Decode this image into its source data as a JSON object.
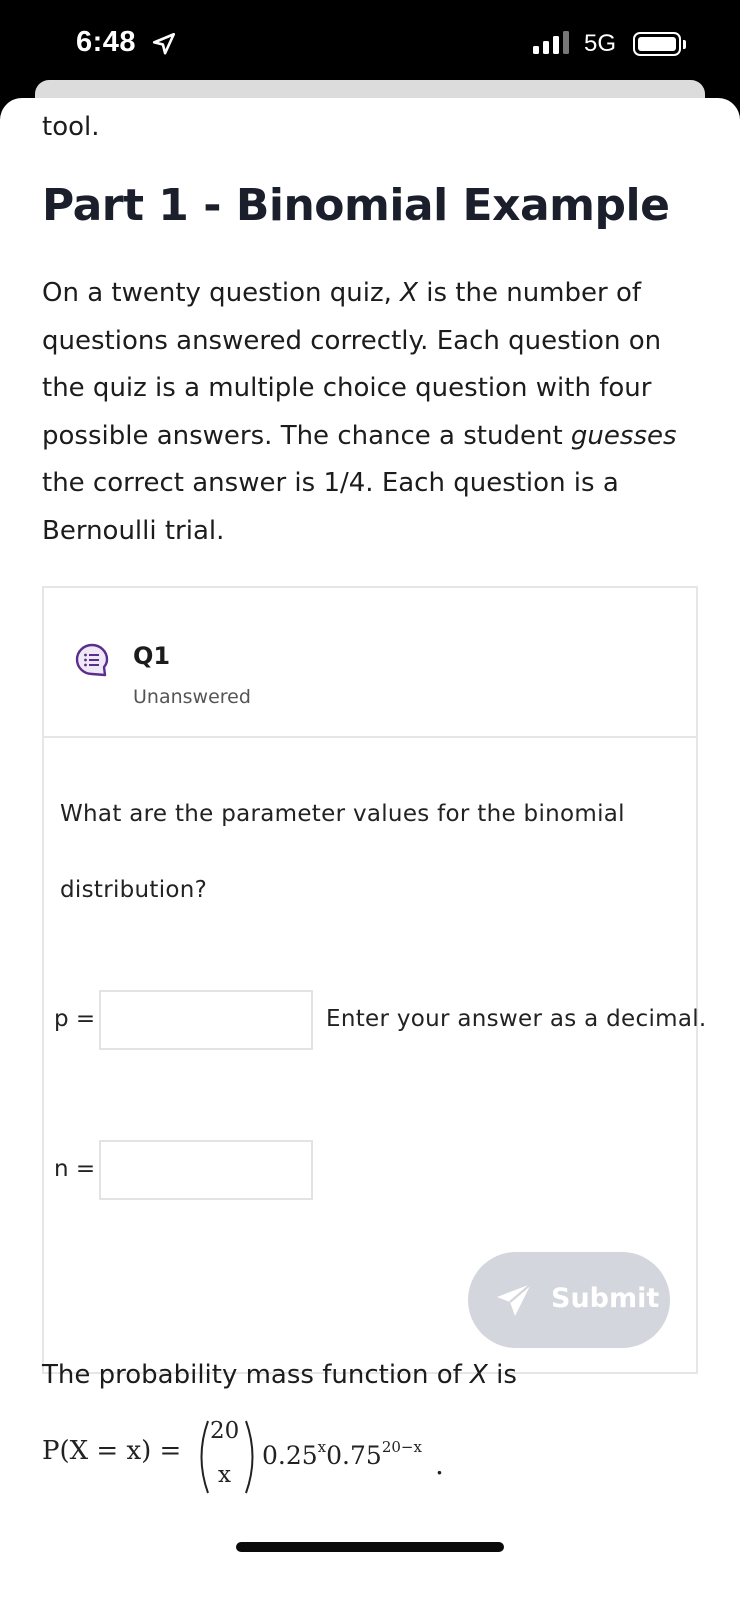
{
  "status_bar": {
    "time": "6:48",
    "network": "5G"
  },
  "content": {
    "previous_text": "tool.",
    "section_title": "Part 1 - Binomial Example",
    "intro": {
      "part1": "On a twenty question quiz, ",
      "var_x": "X",
      "part2": " is the number of questions answered correctly. Each question on the quiz is a multiple choice question with four possible answers. The chance a student ",
      "emph": "guesses",
      "part3": " the correct answer is 1/4. Each question is a Bernoulli trial."
    }
  },
  "question": {
    "label": "Q1",
    "status": "Unanswered",
    "prompt": "What are the parameter values for the binomial distribution?",
    "fields": [
      {
        "label": "p =",
        "value": "",
        "placeholder": ""
      },
      {
        "label": "n =",
        "value": "",
        "placeholder": ""
      }
    ],
    "p_hint": "Enter your answer as a decimal.",
    "submit_label": "Submit"
  },
  "pmf": {
    "intro_prefix": "The probability mass function of ",
    "intro_var": "X",
    "intro_suffix": " is",
    "lhs": "P(X = x) =",
    "binom_top": "20",
    "binom_bottom": "x",
    "base1": "0.25",
    "exp1": "x",
    "base2": "0.75",
    "exp2": "20−x",
    "end": "."
  },
  "colors": {
    "accent_purple": "#5b2d8e",
    "submit_disabled": "#d4d6de",
    "card_border": "#e6e6e6"
  }
}
